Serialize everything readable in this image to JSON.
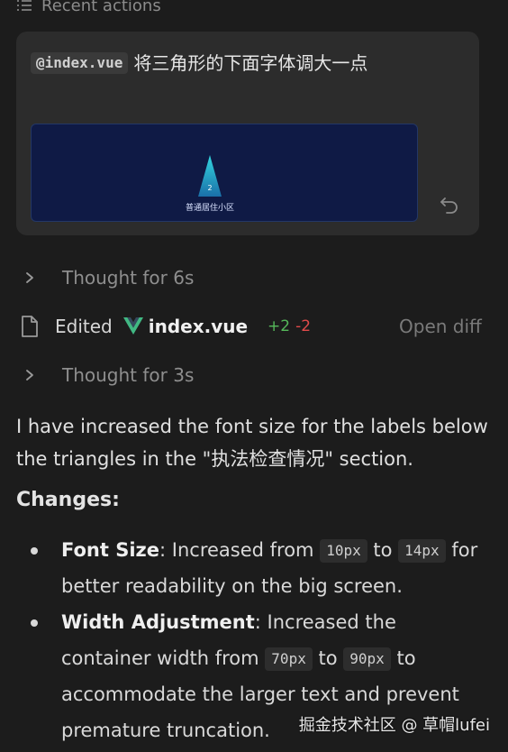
{
  "header": {
    "title": "Recent actions"
  },
  "prompt_card": {
    "mention": "@index.vue",
    "text": "将三角形的下面字体调大一点",
    "thumbnail": {
      "triangle_value": "2",
      "triangle_label": "普通居住小区"
    },
    "undo_icon": "undo-icon"
  },
  "thought1": {
    "label": "Thought for 6s"
  },
  "edit": {
    "label": "Edited",
    "filename": "index.vue",
    "added": "+2",
    "removed": "-2",
    "open_diff": "Open diff"
  },
  "thought2": {
    "label": "Thought for 3s"
  },
  "summary": "I have increased the font size for the labels below the triangles in the \"执法检查情况\" section.",
  "changes_heading": "Changes:",
  "changes": [
    {
      "term": "Font Size",
      "t1": ": Increased from ",
      "c1": "10px",
      "t2": " to ",
      "c2": "14px",
      "t3": " for better readability on the big screen."
    },
    {
      "term": "Width Adjustment",
      "t1": ": Increased the container width from ",
      "c1": "70px",
      "t2": " to ",
      "c2": "90px",
      "t3": " to accommodate the larger text and prevent premature truncation."
    }
  ],
  "watermark": "掘金技术社区 @ 草帽lufei",
  "colors": {
    "added": "#55b85a",
    "removed": "#e04a4a",
    "vue": "#41b883",
    "card_bg": "#2c2c2c"
  }
}
